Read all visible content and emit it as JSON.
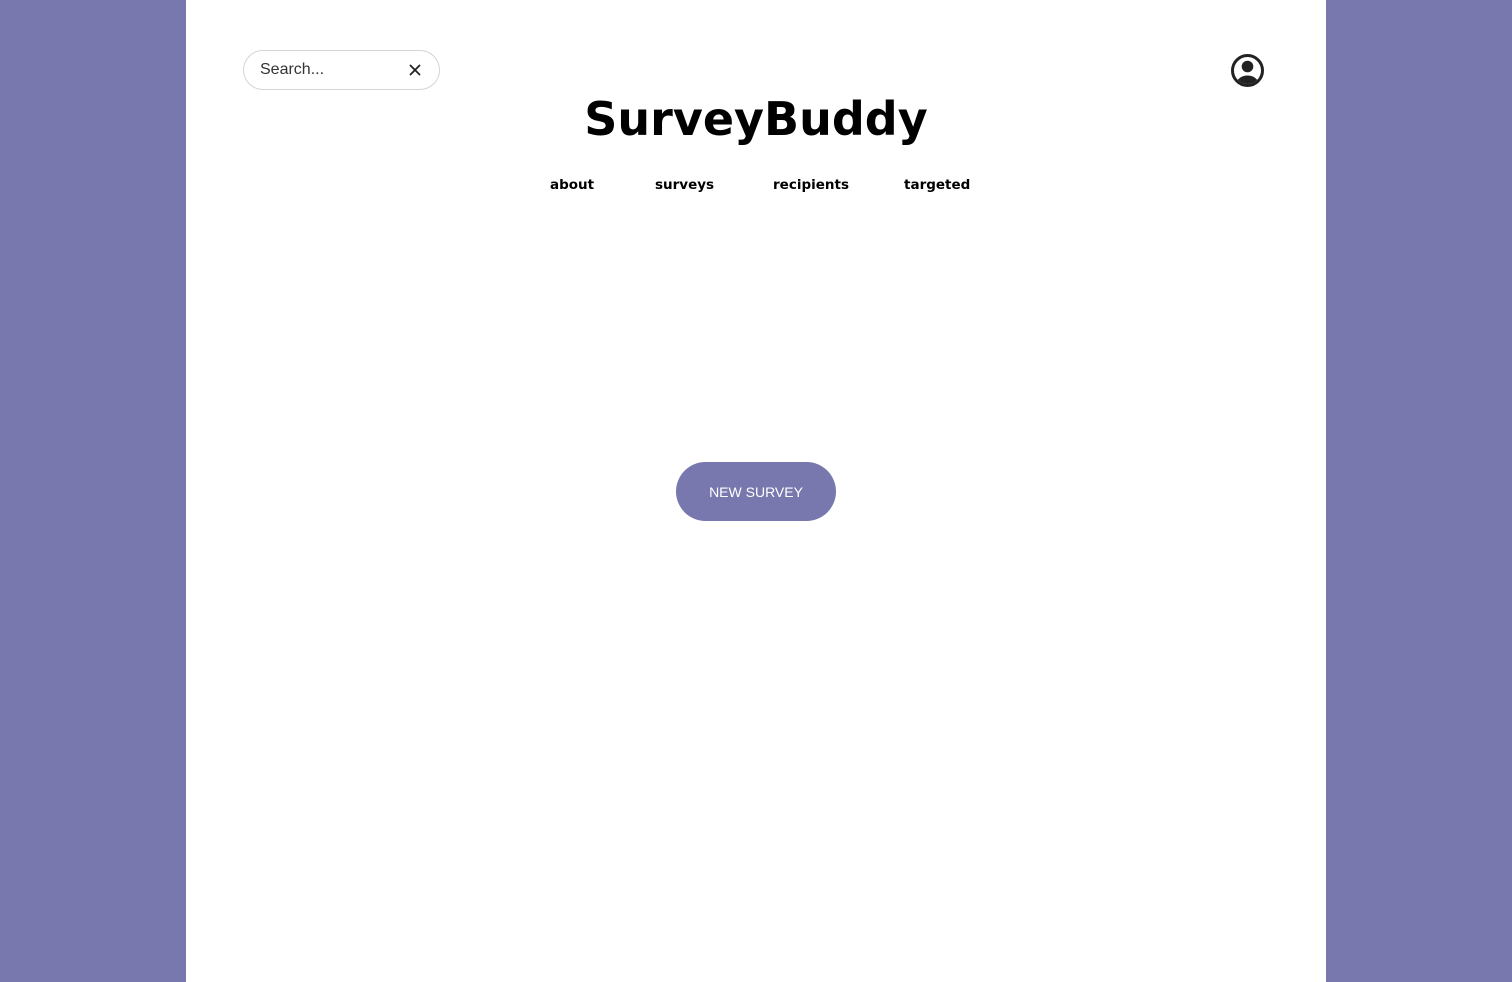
{
  "colors": {
    "background": "#7878ae",
    "surface": "#ffffff",
    "accent": "#7878ae",
    "text": "#000000"
  },
  "header": {
    "search": {
      "placeholder": "Search...",
      "value": "",
      "clear_icon": "close-icon"
    },
    "account_icon": "user-circle-icon"
  },
  "app": {
    "title": "SurveyBuddy"
  },
  "nav": {
    "items": [
      {
        "label": "about"
      },
      {
        "label": "surveys"
      },
      {
        "label": "recipients"
      },
      {
        "label": "targeted"
      }
    ]
  },
  "main": {
    "new_survey_label": "NEW SURVEY"
  }
}
